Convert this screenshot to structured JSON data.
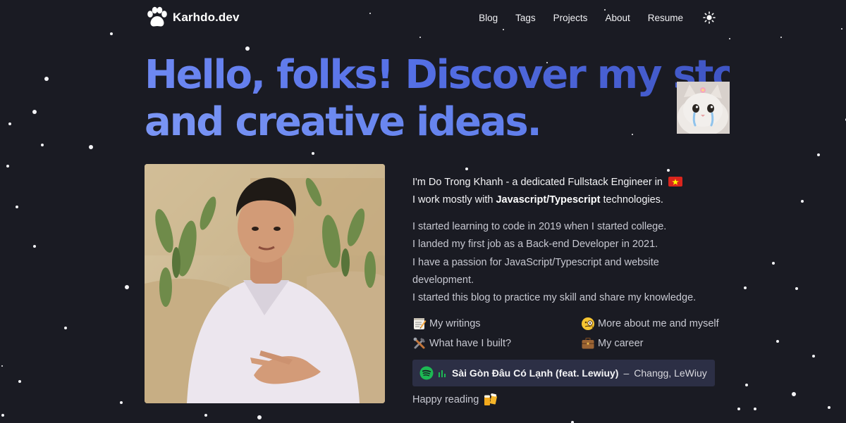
{
  "brand": {
    "name": "Karhdo.dev",
    "logo_icon": "paw-icon"
  },
  "nav": {
    "items": [
      "Blog",
      "Tags",
      "Projects",
      "About",
      "Resume"
    ],
    "theme_icon": "sun-icon"
  },
  "hero": {
    "line1": "Hello, folks! Discover my stories",
    "line2": "and creative ideas."
  },
  "bio": {
    "intro_before": "I'm Do Trong Khanh - a dedicated Fullstack Engineer in",
    "flag_icon": "vietnam-flag-icon",
    "intro2_before": "I work mostly with ",
    "intro2_bold": "Javascript/Typescript",
    "intro2_after": " technologies.",
    "story": [
      "I started learning to code in 2019 when I started college.",
      "I landed my first job as a Back-end Developer in 2021.",
      "I have a passion for JavaScript/Typescript and website development.",
      "I started this blog to practice my skill and share my knowledge."
    ]
  },
  "quick_links": [
    {
      "label": "My writings",
      "icon": "memo-icon"
    },
    {
      "label": "More about me and myself",
      "icon": "monocle-face-icon"
    },
    {
      "label": "What have I built?",
      "icon": "tools-icon"
    },
    {
      "label": "My career",
      "icon": "briefcase-icon"
    }
  ],
  "spotify": {
    "song": "Sài Gòn Đâu Có Lạnh (feat. Lewiuy)",
    "separator": "–",
    "artist": "Changg, LeWiuy",
    "icon": "spotify-icon"
  },
  "footer": {
    "happy": "Happy reading",
    "icon": "beer-mugs-icon"
  },
  "colors": {
    "background": "#1a1b23",
    "accent": "#5b75e8",
    "spotify_card": "#2c2f45",
    "spotify_green": "#1db954"
  }
}
